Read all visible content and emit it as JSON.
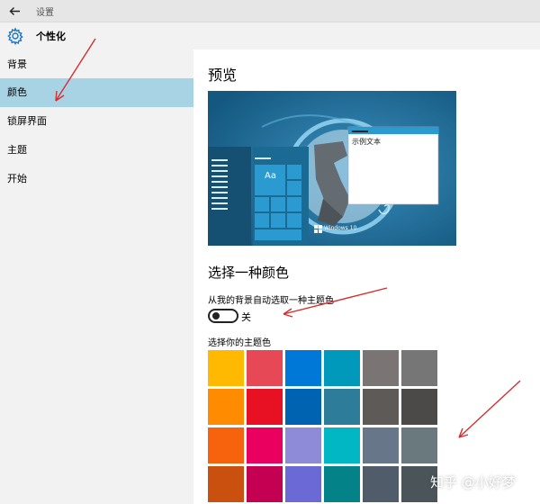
{
  "window": {
    "title": "设置"
  },
  "header": {
    "title": "个性化"
  },
  "sidebar": {
    "items": [
      {
        "label": "背景"
      },
      {
        "label": "颜色"
      },
      {
        "label": "锁屏界面"
      },
      {
        "label": "主题"
      },
      {
        "label": "开始"
      }
    ],
    "selected_index": 1
  },
  "main": {
    "preview_heading": "预览",
    "preview": {
      "sample_text": "示例文本",
      "tile_label": "Aa",
      "os_label": "Windows 10"
    },
    "color_heading": "选择一种颜色",
    "auto_pick_label": "从我的背景自动选取一种主题色",
    "auto_pick_state": "关",
    "pick_label": "选择你的主题色",
    "palette": [
      "#ffb900",
      "#e74856",
      "#0078d7",
      "#0099bc",
      "#7a7574",
      "#767676",
      "#ff8c00",
      "#e81123",
      "#0063b1",
      "#2d7d9a",
      "#5d5a58",
      "#4c4a48",
      "#f7630c",
      "#ea005e",
      "#8e8cd8",
      "#00b7c3",
      "#68768a",
      "#69797e",
      "#ca5010",
      "#c30052",
      "#6b69d6",
      "#038387",
      "#515c6b",
      "#4a5459"
    ]
  },
  "watermark": "知乎 @小好梦",
  "colors": {
    "accent": "#a8d3e4",
    "sidebar_bg": "#f2f2f2",
    "arrow": "#d32f2f"
  }
}
